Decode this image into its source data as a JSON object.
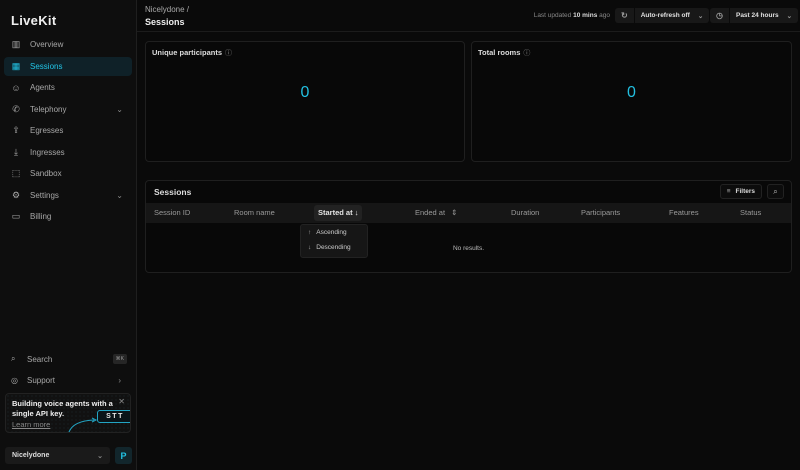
{
  "app": {
    "logo": "LiveKit"
  },
  "sidebar": {
    "items": [
      {
        "label": "Overview",
        "icon": "bar-chart-icon",
        "active": false
      },
      {
        "label": "Sessions",
        "icon": "sessions-grid-icon",
        "active": true
      },
      {
        "label": "Agents",
        "icon": "robot-icon",
        "active": false
      },
      {
        "label": "Telephony",
        "icon": "phone-icon",
        "active": false,
        "expandable": true
      },
      {
        "label": "Egresses",
        "icon": "upload-icon",
        "active": false
      },
      {
        "label": "Ingresses",
        "icon": "download-icon",
        "active": false
      },
      {
        "label": "Sandbox",
        "icon": "sandbox-icon",
        "active": false
      },
      {
        "label": "Settings",
        "icon": "gear-icon",
        "active": false,
        "expandable": true
      },
      {
        "label": "Billing",
        "icon": "card-icon",
        "active": false
      }
    ],
    "search": {
      "label": "Search",
      "shortcut": "⌘K"
    },
    "support": {
      "label": "Support"
    },
    "promo": {
      "text": "Building voice agents with a single API key.",
      "link": "Learn more",
      "badge": "STT"
    },
    "org": {
      "name": "Nicelydone",
      "avatar": "P"
    }
  },
  "header": {
    "breadcrumb": "Nicelydone /",
    "title": "Sessions",
    "updated_prefix": "Last updated",
    "updated_value": "10 mins",
    "updated_suffix": "ago",
    "refresh": "Auto-refresh off",
    "range": "Past 24 hours"
  },
  "stats": [
    {
      "label": "Unique participants",
      "value": "0"
    },
    {
      "label": "Total rooms",
      "value": "0"
    }
  ],
  "sessions": {
    "title": "Sessions",
    "filters": "Filters",
    "columns": [
      "Session ID",
      "Room name",
      "Started at",
      "Ended at",
      "Duration",
      "Participants",
      "Features",
      "Status"
    ],
    "empty": "No results.",
    "sort_menu": [
      "Ascending",
      "Descending"
    ]
  },
  "colors": {
    "accent": "#22c4e6",
    "background": "#0a0a0a"
  }
}
